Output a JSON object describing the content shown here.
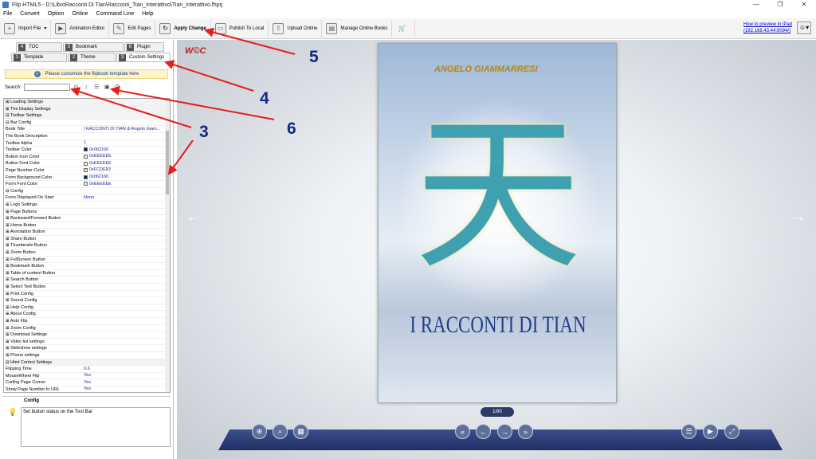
{
  "window": {
    "title": "Flip HTML5 - D:\\LibroRacconti Di Tian\\Racconti_Tian_Interattivo\\Tian_Interattivo.fhprj"
  },
  "menu": [
    "File",
    "Convert",
    "Option",
    "Online",
    "Command Line",
    "Help"
  ],
  "toolbar": {
    "import_file": "Import File",
    "animation_editor": "Animation Editor",
    "edit_pages": "Edit Pages",
    "apply_change": "Apply Change",
    "publish_local": "Publish To Local",
    "upload_online": "Upload Online",
    "manage_books": "Manage Online Books"
  },
  "preview": {
    "line1": "How to preview in iPad",
    "line2": "(192.168.43.44:9094/)"
  },
  "tabs": {
    "row1": [
      {
        "num": "4",
        "label": "TOC"
      },
      {
        "num": "5",
        "label": "Bookmark"
      },
      {
        "num": "6",
        "label": "Plugin"
      }
    ],
    "row2": [
      {
        "num": "1",
        "label": "Template"
      },
      {
        "num": "2",
        "label": "Theme"
      },
      {
        "num": "3",
        "label": "Custom Settings"
      }
    ]
  },
  "customize_text": "Please customize the flipbook template here",
  "search": {
    "label": "Search:",
    "value": ""
  },
  "tree": [
    {
      "k": "⊞ Loading Settings",
      "v": "",
      "grp": true
    },
    {
      "k": "⊞ The Display Settings",
      "v": "",
      "grp": true
    },
    {
      "k": "⊟ Toolbar Settings",
      "v": "",
      "grp": true
    },
    {
      "k": " ⊟ Bar Config",
      "v": "",
      "grp": false
    },
    {
      "k": "     Book Title",
      "v": "I RACCONTI DI TIAN di Angelo Giam...",
      "grp": false
    },
    {
      "k": "     The Book Description",
      "v": "",
      "grp": false
    },
    {
      "k": "     Toolbar Alpha",
      "v": "1",
      "grp": false
    },
    {
      "k": "     Toolbar Color",
      "v": "0x062160",
      "color": "#062160",
      "grp": false
    },
    {
      "k": "     Button Icon Color",
      "v": "0xEEEEEE",
      "color": "#EEEEEE",
      "grp": false
    },
    {
      "k": "     Button Font Color",
      "v": "0xEEEEEE",
      "color": "#EEEEEE",
      "grp": false
    },
    {
      "k": "     Page Number Color",
      "v": "0xFCDE83",
      "color": "#FCDE83",
      "grp": false
    },
    {
      "k": "     Form Background Color",
      "v": "0x062160",
      "color": "#062160",
      "grp": false
    },
    {
      "k": "     Form Font Color",
      "v": "0xEEEEEE",
      "color": "#EEEEEE",
      "grp": false
    },
    {
      "k": " ⊟ Config",
      "v": "",
      "grp": false
    },
    {
      "k": "     Form Displayed On Start",
      "v": "None",
      "grp": false
    },
    {
      "k": "   ⊞ Logo Settings",
      "v": "",
      "grp": false
    },
    {
      "k": "   ⊞ Page Buttons",
      "v": "",
      "grp": false
    },
    {
      "k": "   ⊞ Backward/Forward Button",
      "v": "",
      "grp": false
    },
    {
      "k": "   ⊞ Home Button",
      "v": "",
      "grp": false
    },
    {
      "k": "   ⊞ Annotation Button",
      "v": "",
      "grp": false
    },
    {
      "k": "   ⊞ Share Button",
      "v": "",
      "grp": false
    },
    {
      "k": "   ⊞ Thumbnails Button",
      "v": "",
      "grp": false
    },
    {
      "k": "   ⊞ Zoom Button",
      "v": "",
      "grp": false
    },
    {
      "k": "   ⊞ FullScreen Button",
      "v": "",
      "grp": false
    },
    {
      "k": "   ⊞ Bookmark Button",
      "v": "",
      "grp": false
    },
    {
      "k": "   ⊞ Table of content Button",
      "v": "",
      "grp": false
    },
    {
      "k": "   ⊞ Search Button",
      "v": "",
      "grp": false
    },
    {
      "k": "   ⊞ Select Text Button",
      "v": "",
      "grp": false
    },
    {
      "k": "   ⊞ Print Config",
      "v": "",
      "grp": false
    },
    {
      "k": "   ⊞ Sound Config",
      "v": "",
      "grp": false
    },
    {
      "k": "   ⊞ Help Config",
      "v": "",
      "grp": false
    },
    {
      "k": "   ⊞ About Config",
      "v": "",
      "grp": false
    },
    {
      "k": "   ⊞ Auto Flip",
      "v": "",
      "grp": false
    },
    {
      "k": "   ⊞ Zoom Config",
      "v": "",
      "grp": false
    },
    {
      "k": "   ⊞ Download Settings",
      "v": "",
      "grp": false
    },
    {
      "k": "   ⊞ Video list settings",
      "v": "",
      "grp": false
    },
    {
      "k": "   ⊞ Slideshow settings",
      "v": "",
      "grp": false
    },
    {
      "k": "   ⊞ Phone settings",
      "v": "",
      "grp": false
    },
    {
      "k": "⊟ Html Control Settings",
      "v": "",
      "grp": true
    },
    {
      "k": "     Flipping Time",
      "v": "0.6",
      "grp": false
    },
    {
      "k": "     MouseWheel Flip",
      "v": "Yes",
      "grp": false
    },
    {
      "k": "     Curling Page Corner",
      "v": "Yes",
      "grp": false
    },
    {
      "k": "     Show Page Number In URL",
      "v": "Yes",
      "grp": false
    }
  ],
  "config_panel": {
    "title": "Config",
    "desc": "Set button status on the Tool Bar"
  },
  "book": {
    "author": "ANGELO GIAMMARRESI",
    "title": "I RACCONTI DI TIAN",
    "glyph": "天",
    "logo": "W©C"
  },
  "page_indicator": "1/80",
  "annotations": [
    "5",
    "4",
    "6",
    "3"
  ]
}
